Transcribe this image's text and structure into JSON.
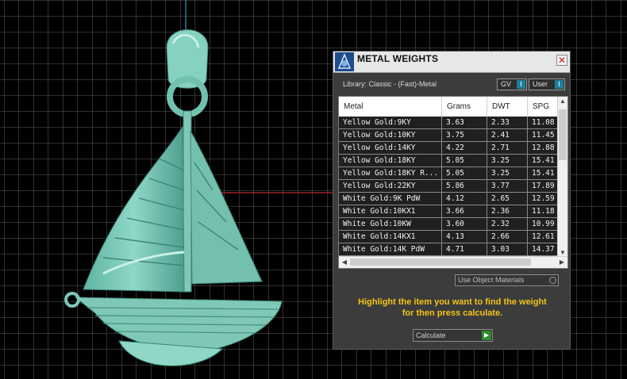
{
  "viewport": {
    "background": "#000000",
    "grid_color": "#5e5e5e",
    "model_color": "#7fc8b8",
    "axis_colors": {
      "x": "#c0282c",
      "z": "#2aa0c8"
    }
  },
  "panel": {
    "title": "METAL WEIGHTS",
    "close_label": "✕",
    "library_label": "Library: Classic - (Fast)-Metal",
    "gv_label": "GV",
    "user_label": "User",
    "toggle_mark": "I",
    "columns": [
      "Metal",
      "Grams",
      "DWT",
      "SPG"
    ],
    "rows": [
      [
        "Yellow Gold:9KY",
        "3.63",
        "2.33",
        "11.08"
      ],
      [
        "Yellow Gold:10KY",
        "3.75",
        "2.41",
        "11.45"
      ],
      [
        "Yellow Gold:14KY",
        "4.22",
        "2.71",
        "12.88"
      ],
      [
        "Yellow Gold:18KY",
        "5.05",
        "3.25",
        "15.41"
      ],
      [
        "Yellow Gold:18KY R...",
        "5.05",
        "3.25",
        "15.41"
      ],
      [
        "Yellow Gold:22KY",
        "5.86",
        "3.77",
        "17.89"
      ],
      [
        "White Gold:9K PdW",
        "4.12",
        "2.65",
        "12.59"
      ],
      [
        "White Gold:10KX1",
        "3.66",
        "2.36",
        "11.18"
      ],
      [
        "White Gold:10KW",
        "3.60",
        "2.32",
        "10.99"
      ],
      [
        "White Gold:14KX1",
        "4.13",
        "2.66",
        "12.61"
      ],
      [
        "White Gold:14K PdW",
        "4.71",
        "3.03",
        "14.37"
      ]
    ],
    "use_object_materials": "Use Object Materials",
    "hint_line1": "Highlight the item you want to find the weight",
    "hint_line2": "for then press calculate.",
    "calculate_label": "Calculate",
    "go_glyph": "▶",
    "accent_color": "#f2c417",
    "toggle_color": "#1f7f9a",
    "go_color": "#2f8a2f"
  }
}
